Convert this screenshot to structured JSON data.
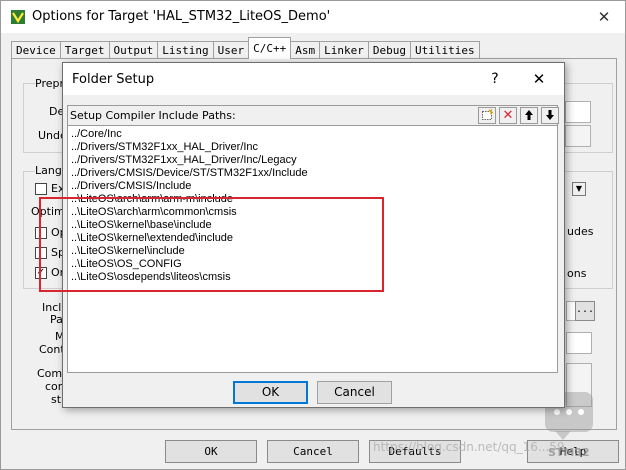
{
  "main_window": {
    "title": "Options for Target 'HAL_STM32_LiteOS_Demo'",
    "tabs": [
      {
        "label": "Device",
        "active": false
      },
      {
        "label": "Target",
        "active": false
      },
      {
        "label": "Output",
        "active": false
      },
      {
        "label": "Listing",
        "active": false
      },
      {
        "label": "User",
        "active": false
      },
      {
        "label": "C/C++",
        "active": true
      },
      {
        "label": "Asm",
        "active": false
      },
      {
        "label": "Linker",
        "active": false
      },
      {
        "label": "Debug",
        "active": false
      },
      {
        "label": "Utilities",
        "active": false
      }
    ],
    "partial_labels": {
      "prepro": "Prepro",
      "def": "Def",
      "undef": "Unde",
      "langu": "Langu",
      "ex": "Ex",
      "optimiz": "Optimiz",
      "op": "Op",
      "sp": "Sp",
      "on": "On",
      "udes": "udes",
      "ons": "ons",
      "inclu": "Inclu",
      "path": "Path",
      "m": "M",
      "contr": "Contr",
      "comp": "Comp",
      "con": "con",
      "str": "str",
      "browse": "..."
    },
    "buttons": {
      "ok": "OK",
      "cancel": "Cancel",
      "defaults": "Defaults",
      "help": "Help"
    }
  },
  "folder_setup": {
    "title": "Folder Setup",
    "help_glyph": "?",
    "close_glyph": "✕",
    "header_label": "Setup Compiler Include Paths:",
    "toolbar": [
      {
        "name": "new-folder-icon",
        "glyph": "⬚"
      },
      {
        "name": "delete-icon",
        "glyph": "✕"
      },
      {
        "name": "move-up-icon",
        "glyph": "🡑"
      },
      {
        "name": "move-down-icon",
        "glyph": "🡓"
      }
    ],
    "paths": [
      "../Core/Inc",
      "../Drivers/STM32F1xx_HAL_Driver/Inc",
      "../Drivers/STM32F1xx_HAL_Driver/Inc/Legacy",
      "../Drivers/CMSIS/Device/ST/STM32F1xx/Include",
      "../Drivers/CMSIS/Include",
      "..\\LiteOS\\arch\\arm\\arm-m\\include",
      "..\\LiteOS\\arch\\arm\\common\\cmsis",
      "..\\LiteOS\\kernel\\base\\include",
      "..\\LiteOS\\kernel\\extended\\include",
      "..\\LiteOS\\kernel\\include",
      "..\\LiteOS\\OS_CONFIG",
      "..\\LiteOS\\osdepends\\liteos\\cmsis"
    ],
    "ok_label": "OK",
    "cancel_label": "Cancel",
    "highlight_color": "#d9262e"
  },
  "watermark": {
    "text": "https://blog.csdn.net/qq_16...59",
    "brand": "STM32"
  }
}
